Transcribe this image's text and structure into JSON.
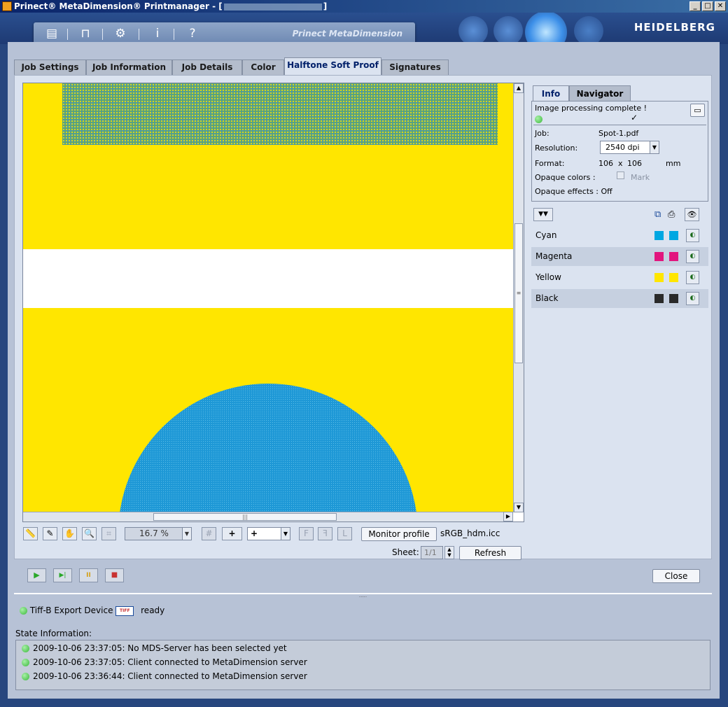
{
  "window": {
    "title": "Prinect® MetaDimension® Printmanager - [",
    "title_end": "]",
    "minimize": "_",
    "maximize": "□",
    "close": "✕"
  },
  "banner": {
    "product": "Prinect MetaDimension",
    "brand": "HEIDELBERG",
    "info_icon": "i",
    "help_icon": "?"
  },
  "tabs": [
    {
      "label": "Job Settings",
      "active": false
    },
    {
      "label": "Job Information",
      "active": false
    },
    {
      "label": "Job Details",
      "active": false
    },
    {
      "label": "Color",
      "active": false
    },
    {
      "label": "Halftone Soft Proof",
      "active": true
    },
    {
      "label": "Signatures",
      "active": false
    }
  ],
  "preview": {
    "colors": {
      "yellow": "#ffe600",
      "cyan": "#1e98d6",
      "white": "#ffffff"
    }
  },
  "view_controls": {
    "zoom": "16.7 %",
    "add_symbol": "+",
    "crosshair_select": "+",
    "monitor_profile_label": "Monitor profile",
    "monitor_profile_value": "sRGB_hdm.icc",
    "sheet_label": "Sheet:",
    "sheet_value": "1/1",
    "refresh_label": "Refresh"
  },
  "right_tabs": [
    {
      "label": "Info",
      "active": true
    },
    {
      "label": "Navigator",
      "active": false
    }
  ],
  "info": {
    "status": "Image processing complete !",
    "check": "✓",
    "job_label": "Job:",
    "job_value": "Spot-1.pdf",
    "resolution_label": "Resolution:",
    "resolution_value": "2540 dpi",
    "format_label": "Format:",
    "format_w": "106",
    "format_x": "x",
    "format_h": "106",
    "format_unit": "mm",
    "opaque_colors_label": "Opaque colors :",
    "mark_label": "Mark",
    "opaque_effects": "Opaque effects : Off"
  },
  "separations": [
    {
      "name": "Cyan",
      "color": "#00a7e2"
    },
    {
      "name": "Magenta",
      "color": "#e2157e"
    },
    {
      "name": "Yellow",
      "color": "#ffe600"
    },
    {
      "name": "Black",
      "color": "#2a2a2a"
    }
  ],
  "playback": {
    "play": "▶",
    "step": "▶|",
    "pause": "II",
    "stop": "■",
    "close_label": "Close"
  },
  "device": {
    "name": "Tiff-B Export Device",
    "icon_text": "TIFF",
    "state": "ready"
  },
  "state_info": {
    "label": "State Information:",
    "entries": [
      "2009-10-06 23:37:05: No MDS-Server has been selected yet",
      "2009-10-06 23:37:05: Client connected to MetaDimension server",
      "2009-10-06 23:36:44: Client connected to MetaDimension server"
    ]
  }
}
